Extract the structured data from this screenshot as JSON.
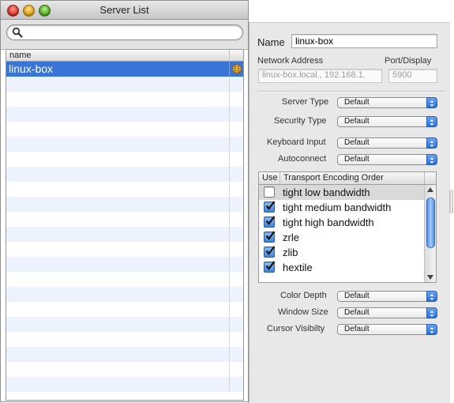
{
  "window": {
    "title": "Server List"
  },
  "search": {
    "placeholder": "",
    "value": ""
  },
  "server_table": {
    "column_header": "name",
    "rows": [
      {
        "name": "linux-box",
        "selected": true
      }
    ],
    "empty_row_count": 21
  },
  "settings": {
    "name_label": "Name",
    "name_value": "linux-box",
    "network_address_label": "Network Address",
    "network_address_value": "linux-box.local., 192.168.1.",
    "port_display_label": "Port/Display",
    "port_display_value": "5900",
    "server_type_label": "Server Type",
    "server_type_value": "Default",
    "security_type_label": "Security Type",
    "security_type_value": "Default",
    "keyboard_input_label": "Keyboard Input",
    "keyboard_input_value": "Default",
    "autoconnect_label": "Autoconnect",
    "autoconnect_value": "Default",
    "encoding_table": {
      "use_header": "Use",
      "order_header": "Transport Encoding Order",
      "items": [
        {
          "label": "tight low bandwidth",
          "checked": false
        },
        {
          "label": "tight medium bandwidth",
          "checked": true
        },
        {
          "label": "tight high bandwidth",
          "checked": true
        },
        {
          "label": "zrle",
          "checked": true
        },
        {
          "label": "zlib",
          "checked": true
        },
        {
          "label": "hextile",
          "checked": true
        }
      ]
    },
    "color_depth_label": "Color Depth",
    "color_depth_value": "Default",
    "window_size_label": "Window Size",
    "window_size_value": "Default",
    "cursor_visibility_label": "Cursor Visibilty",
    "cursor_visibility_value": "Default"
  },
  "icons": {
    "search": "magnifier-icon",
    "server_status": "network-globe-icon",
    "popup_arrows": "up-down-chevron-icon",
    "checkbox": "checkmark-icon"
  },
  "colors": {
    "selection": "#3875d7",
    "alt_row": "#edf3fe",
    "panel_bg": "#e8e8e8",
    "accent_blue": "#2b6ed8"
  }
}
